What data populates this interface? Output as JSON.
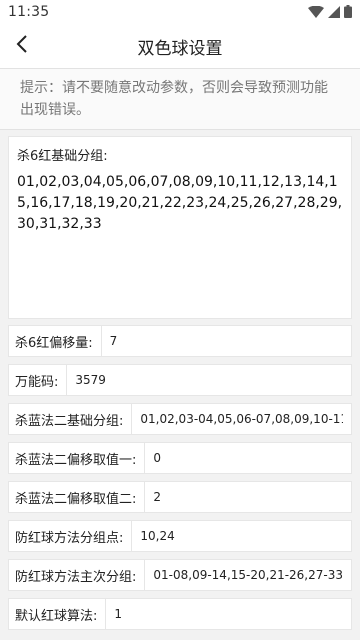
{
  "status_bar": {
    "time": "11:35"
  },
  "app_bar": {
    "title": "双色球设置"
  },
  "hint": {
    "text": "提示：请不要随意改动参数，否则会导致预测功能出现错误。"
  },
  "red_base_group": {
    "label": "杀6红基础分组:",
    "value": "01,02,03,04,05,06,07,08,09,10,11,12,13,14,15,16,17,18,19,20,21,22,23,24,25,26,27,28,29,30,31,32,33"
  },
  "fields": [
    {
      "label": "杀6红偏移量:",
      "value": "7"
    },
    {
      "label": "万能码:",
      "value": "3579"
    },
    {
      "label": "杀蓝法二基础分组:",
      "value": "01,02,03-04,05,06-07,08,09,10-11,12,1"
    },
    {
      "label": "杀蓝法二偏移取值一:",
      "value": "0"
    },
    {
      "label": "杀蓝法二偏移取值二:",
      "value": "2"
    },
    {
      "label": "防红球方法分组点:",
      "value": "10,24"
    },
    {
      "label": "防红球方法主次分组:",
      "value": "01-08,09-14,15-20,21-26,27-33"
    },
    {
      "label": "默认红球算法:",
      "value": "1"
    }
  ],
  "colors": {
    "background": "#f2f2f2",
    "card": "#ffffff",
    "border": "#e6e6e6",
    "hint_text": "#777777"
  },
  "icons": {
    "wifi": "wifi-icon",
    "signal": "signal-icon",
    "battery": "battery-icon",
    "back": "back-arrow-icon"
  }
}
